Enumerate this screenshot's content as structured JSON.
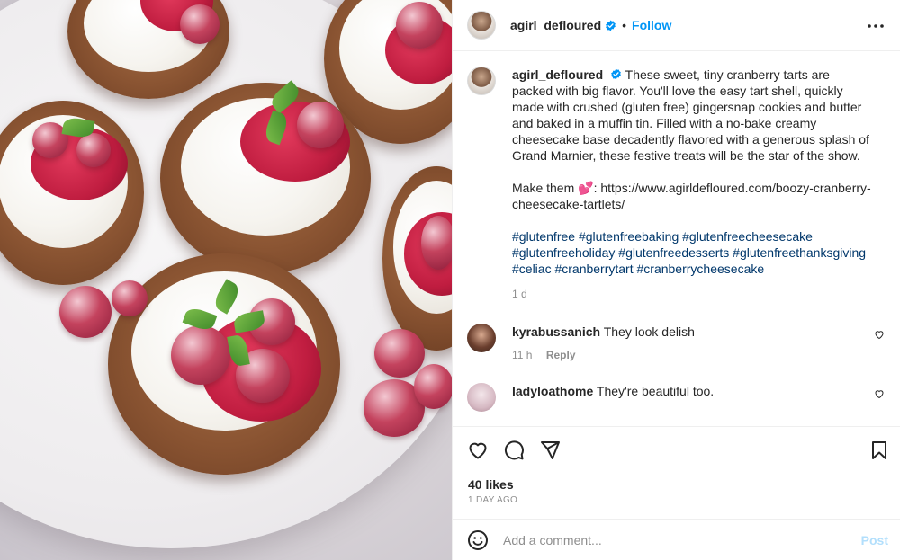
{
  "post": {
    "username": "agirl_defloured",
    "separator": "•",
    "follow_label": "Follow",
    "photo_alt": "Cranberry cheesecake tarts on a marble cake stand"
  },
  "caption": {
    "username": "agirl_defloured",
    "text": "These sweet, tiny cranberry tarts are packed with big flavor. You'll love the easy tart shell, quickly made with crushed (gluten free) gingersnap cookies and butter and baked in a muffin tin. Filled with a no-bake creamy cheesecake base decadently flavored with a generous splash of Grand Marnier, these festive treats will be the star of the show.\n\nMake them 💕: https://www.agirldefloured.com/boozy-cranberry-cheesecake-tartlets/",
    "hashtags": "#glutenfree #glutenfreebaking #glutenfreecheesecake #glutenfreeholiday #glutenfreedesserts #glutenfreethanksgiving #celiac #cranberrytart #cranberrycheesecake",
    "age": "1 d"
  },
  "comments": [
    {
      "username": "kyrabussanich",
      "text": "They look delish",
      "age": "11 h",
      "reply_label": "Reply"
    },
    {
      "username": "ladyloathome",
      "text": "They're beautiful too.",
      "age": "",
      "reply_label": ""
    }
  ],
  "engagement": {
    "likes": "40 likes",
    "posted": "1 DAY AGO"
  },
  "add_comment": {
    "placeholder": "Add a comment...",
    "post_label": "Post"
  },
  "icons": {
    "verified": "verified-badge-icon",
    "more": "more-options-icon",
    "like": "heart-icon",
    "comment": "comment-icon",
    "share": "send-icon",
    "save": "bookmark-icon",
    "emoji": "emoji-icon"
  },
  "colors": {
    "accent": "#0095f6",
    "hashtag": "#00376b",
    "muted": "#8e8e8e",
    "post_disabled": "#b2dffc"
  }
}
